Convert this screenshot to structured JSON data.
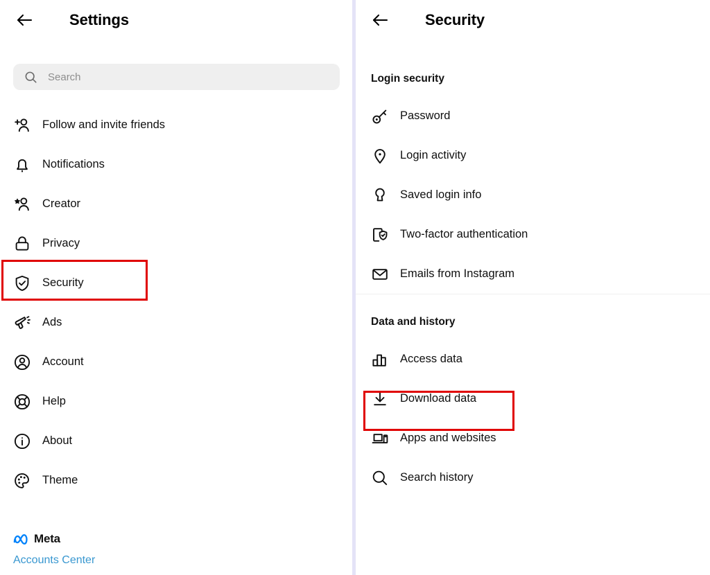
{
  "app": {
    "brand_blue": "#0082fb",
    "link_blue": "#3897d0",
    "highlight_red": "#e00000",
    "divider_lavender": "#e4e3f7"
  },
  "left_panel": {
    "back_icon": "arrow-left-icon",
    "title": "Settings",
    "search": {
      "icon": "search-icon",
      "value": "",
      "placeholder": "Search"
    },
    "items": [
      {
        "icon": "person-add-icon",
        "label": "Follow and invite friends",
        "highlighted": false
      },
      {
        "icon": "bell-icon",
        "label": "Notifications",
        "highlighted": false
      },
      {
        "icon": "person-star-icon",
        "label": "Creator",
        "highlighted": false
      },
      {
        "icon": "lock-icon",
        "label": "Privacy",
        "highlighted": false
      },
      {
        "icon": "shield-check-icon",
        "label": "Security",
        "highlighted": true
      },
      {
        "icon": "megaphone-icon",
        "label": "Ads",
        "highlighted": false
      },
      {
        "icon": "person-circle-icon",
        "label": "Account",
        "highlighted": false
      },
      {
        "icon": "lifebuoy-icon",
        "label": "Help",
        "highlighted": false
      },
      {
        "icon": "info-circle-icon",
        "label": "About",
        "highlighted": false
      },
      {
        "icon": "palette-icon",
        "label": "Theme",
        "highlighted": false
      }
    ],
    "footer": {
      "meta_logo_icon": "meta-infinity-icon",
      "meta_label": "Meta",
      "accounts_center_label": "Accounts Center"
    }
  },
  "right_panel": {
    "back_icon": "arrow-left-icon",
    "title": "Security",
    "sections": [
      {
        "heading": "Login security",
        "items": [
          {
            "icon": "key-icon",
            "label": "Password",
            "highlighted": false
          },
          {
            "icon": "location-pin-icon",
            "label": "Login activity",
            "highlighted": false
          },
          {
            "icon": "keyhole-icon",
            "label": "Saved login info",
            "highlighted": false
          },
          {
            "icon": "device-shield-icon",
            "label": "Two-factor authentication",
            "highlighted": false
          },
          {
            "icon": "envelope-icon",
            "label": "Emails from Instagram",
            "highlighted": false
          }
        ]
      },
      {
        "heading": "Data and history",
        "items": [
          {
            "icon": "bar-chart-icon",
            "label": "Access data",
            "highlighted": false
          },
          {
            "icon": "download-icon",
            "label": "Download data",
            "highlighted": true
          },
          {
            "icon": "devices-icon",
            "label": "Apps and websites",
            "highlighted": false
          },
          {
            "icon": "search-icon",
            "label": "Search history",
            "highlighted": false
          }
        ]
      }
    ]
  }
}
